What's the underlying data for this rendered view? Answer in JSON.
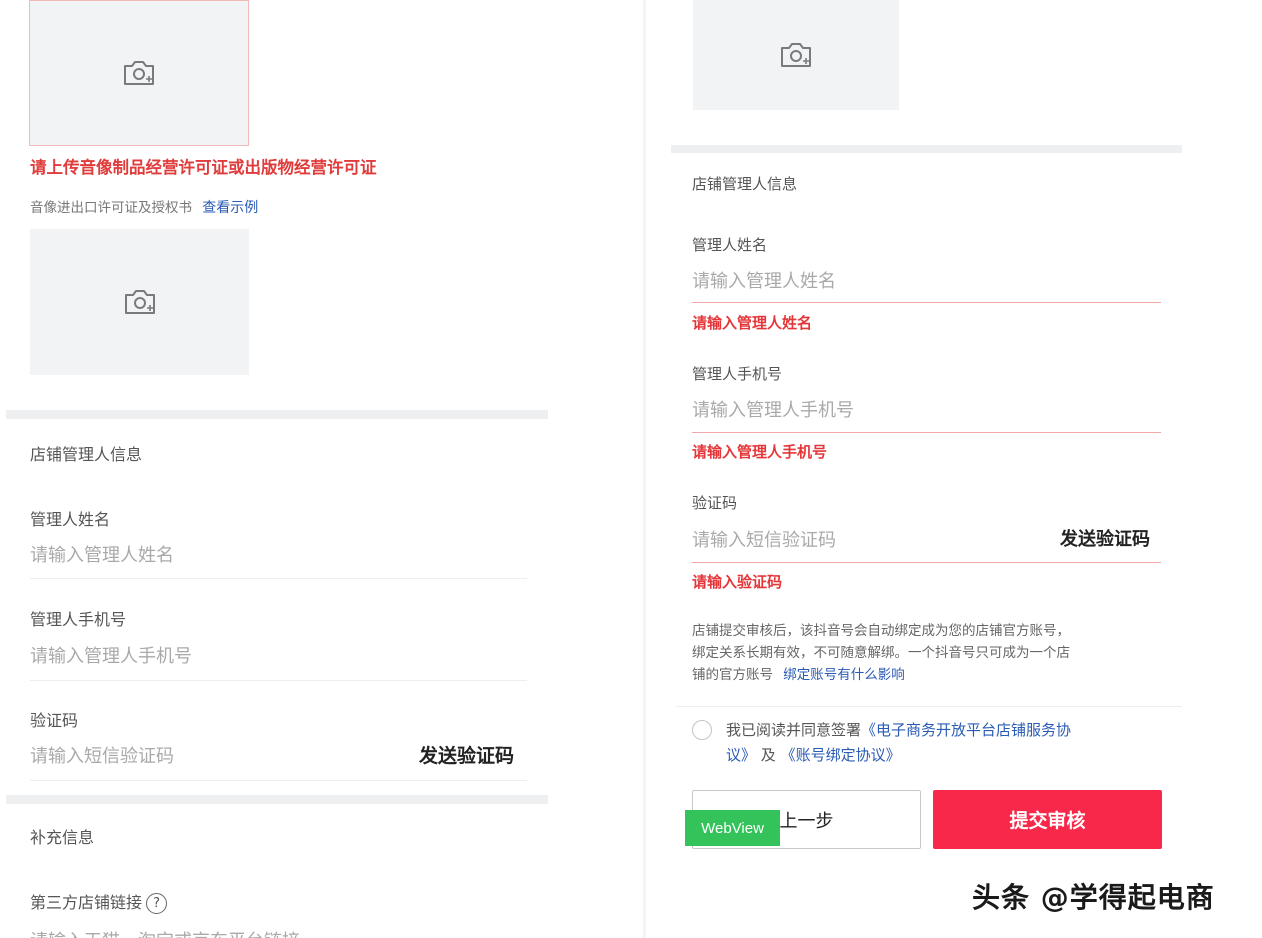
{
  "left": {
    "error_upload_license": "请上传音像制品经营许可证或出版物经营许可证",
    "import_license_label": "音像进出口许可证及授权书",
    "view_example_link": "查看示例",
    "manager_section_title": "店铺管理人信息",
    "manager_name_label": "管理人姓名",
    "manager_name_placeholder": "请输入管理人姓名",
    "manager_phone_label": "管理人手机号",
    "manager_phone_placeholder": "请输入管理人手机号",
    "code_label": "验证码",
    "code_placeholder": "请输入短信验证码",
    "send_code": "发送验证码",
    "supplement_title": "补充信息",
    "third_party_label": "第三方店铺链接",
    "question_mark": "?",
    "third_party_placeholder": "请输入天猫、淘宝或京东平台链接"
  },
  "right": {
    "manager_section_title": "店铺管理人信息",
    "manager_name_label": "管理人姓名",
    "manager_name_placeholder": "请输入管理人姓名",
    "manager_name_error": "请输入管理人姓名",
    "manager_phone_label": "管理人手机号",
    "manager_phone_placeholder": "请输入管理人手机号",
    "manager_phone_error": "请输入管理人手机号",
    "code_label": "验证码",
    "code_placeholder": "请输入短信验证码",
    "send_code": "发送验证码",
    "code_error": "请输入验证码",
    "notice_line1": "店铺提交审核后，该抖音号会自动绑定成为您的店铺官方账号，",
    "notice_line2": "绑定关系长期有效，不可随意解绑。一个抖音号只可成为一个店",
    "notice_line3_prefix": "铺的官方账号",
    "notice_link": "绑定账号有什么影响",
    "agree_prefix": "我已阅读并同意签署",
    "agree_link1_part1": "《电子商务开放平台店铺服务协",
    "agree_link1_part2": "议》",
    "agree_and": " 及 ",
    "agree_link2": "《账号绑定协议》",
    "prev_button": "上一步",
    "submit_button": "提交审核",
    "webview_badge": "WebView"
  },
  "watermark": "头条 @学得起电商",
  "colors": {
    "error": "#e5373a",
    "link": "#2a5bb5",
    "primary_button": "#f7284a",
    "badge": "#33c35a"
  }
}
